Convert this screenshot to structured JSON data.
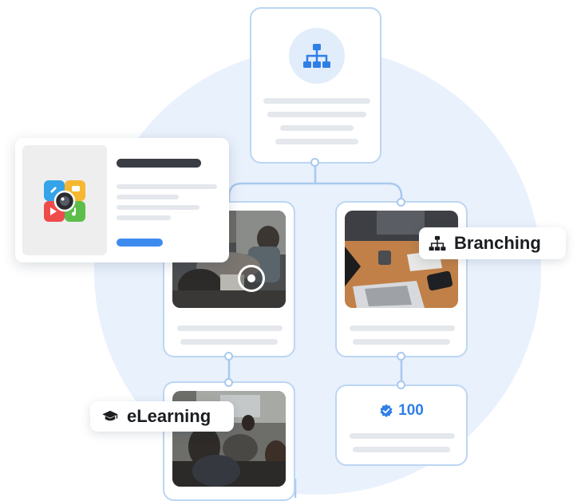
{
  "labels": {
    "branching": "Branching",
    "elearning": "eLearning",
    "score": "100"
  },
  "icons": {
    "top_node": "sitemap-icon",
    "branching": "sitemap-icon",
    "elearning": "graduation-cap-icon",
    "score": "verified-badge-icon",
    "popup_app": "media-app-icon",
    "video": "play-circle-icon"
  },
  "colors": {
    "accent": "#2f7fe6",
    "card_border": "#bcd6f3",
    "connector": "#a9c9ee",
    "background_circle": "#e9f1fc",
    "text_dark": "#1b1d21",
    "placeholder_line": "#e4e7ec"
  }
}
